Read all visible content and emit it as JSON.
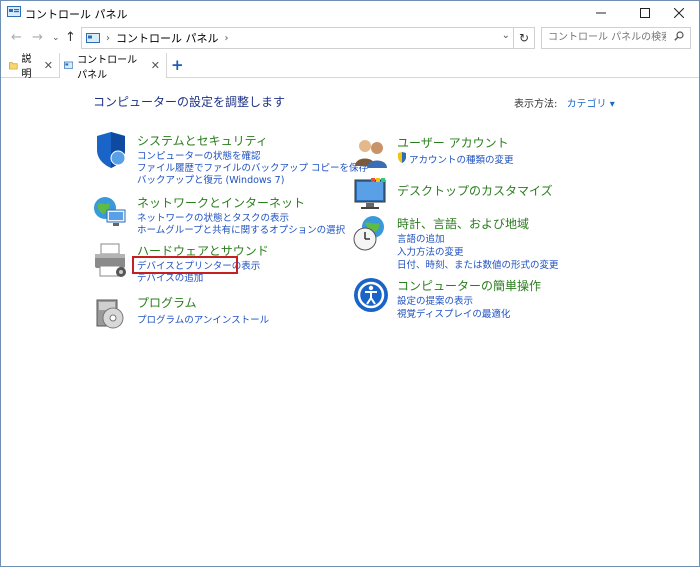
{
  "window": {
    "title": "コントロール パネル"
  },
  "address": {
    "crumb": "コントロール パネル"
  },
  "search": {
    "placeholder": "コントロール パネルの検索"
  },
  "tabs": [
    {
      "label": "説明"
    },
    {
      "label": "コントロール パネル"
    }
  ],
  "main": {
    "heading": "コンピューターの設定を調整します",
    "view_by_label": "表示方法:",
    "view_by_value": "カテゴリ ▾"
  },
  "categories_left": [
    {
      "title": "システムとセキュリティ",
      "links": [
        "コンピューターの状態を確認",
        "ファイル履歴でファイルのバックアップ コピーを保存",
        "バックアップと復元 (Windows 7)"
      ]
    },
    {
      "title": "ネットワークとインターネット",
      "links": [
        "ネットワークの状態とタスクの表示",
        "ホームグループと共有に関するオプションの選択"
      ]
    },
    {
      "title": "ハードウェアとサウンド",
      "links": [
        "デバイスとプリンターの表示",
        "デバイスの追加"
      ]
    },
    {
      "title": "プログラム",
      "links": [
        "プログラムのアンインストール"
      ]
    }
  ],
  "categories_right": [
    {
      "title": "ユーザー アカウント",
      "links": [
        "アカウントの種類の変更"
      ]
    },
    {
      "title": "デスクトップのカスタマイズ",
      "links": []
    },
    {
      "title": "時計、言語、および地域",
      "links": [
        "言語の追加",
        "入力方法の変更",
        "日付、時刻、または数値の形式の変更"
      ]
    },
    {
      "title": "コンピューターの簡単操作",
      "links": [
        "設定の提案の表示",
        "視覚ディスプレイの最適化"
      ]
    }
  ],
  "colors": {
    "category_title": "#2a7d1e",
    "link": "#1f52c0",
    "heading": "#1e3287",
    "highlight": "#c42020"
  }
}
